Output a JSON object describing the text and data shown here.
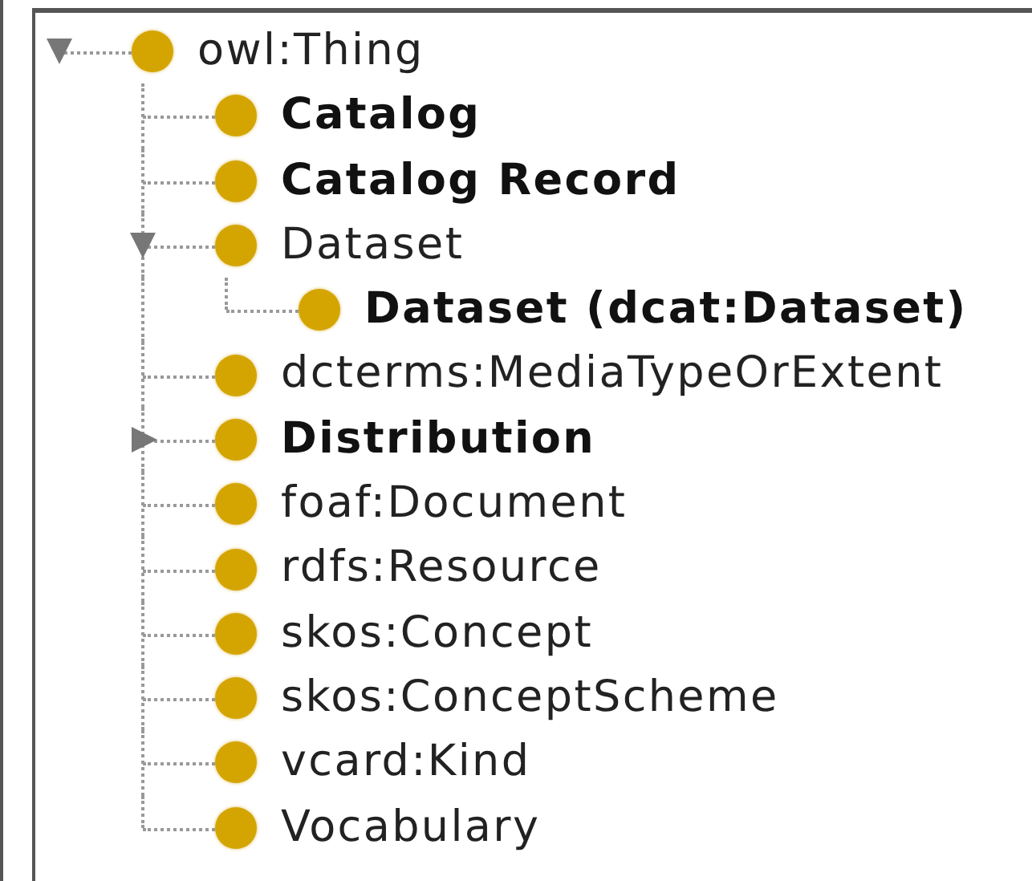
{
  "class_tree": [
    {
      "label": "owl:Thing",
      "bold": false,
      "expanded": true,
      "children": [
        {
          "label": "Catalog",
          "bold": true
        },
        {
          "label": "Catalog Record",
          "bold": true
        },
        {
          "label": "Dataset",
          "bold": false,
          "expanded": true,
          "children": [
            {
              "label": "Dataset (dcat:Dataset)",
              "bold": true
            }
          ]
        },
        {
          "label": "dcterms:MediaTypeOrExtent",
          "bold": false
        },
        {
          "label": "Distribution",
          "bold": true,
          "expanded": false
        },
        {
          "label": "foaf:Document",
          "bold": false
        },
        {
          "label": "rdfs:Resource",
          "bold": false
        },
        {
          "label": "skos:Concept",
          "bold": false
        },
        {
          "label": "skos:ConceptScheme",
          "bold": false
        },
        {
          "label": "vcard:Kind",
          "bold": false
        },
        {
          "label": "Vocabulary",
          "bold": false
        }
      ]
    }
  ]
}
